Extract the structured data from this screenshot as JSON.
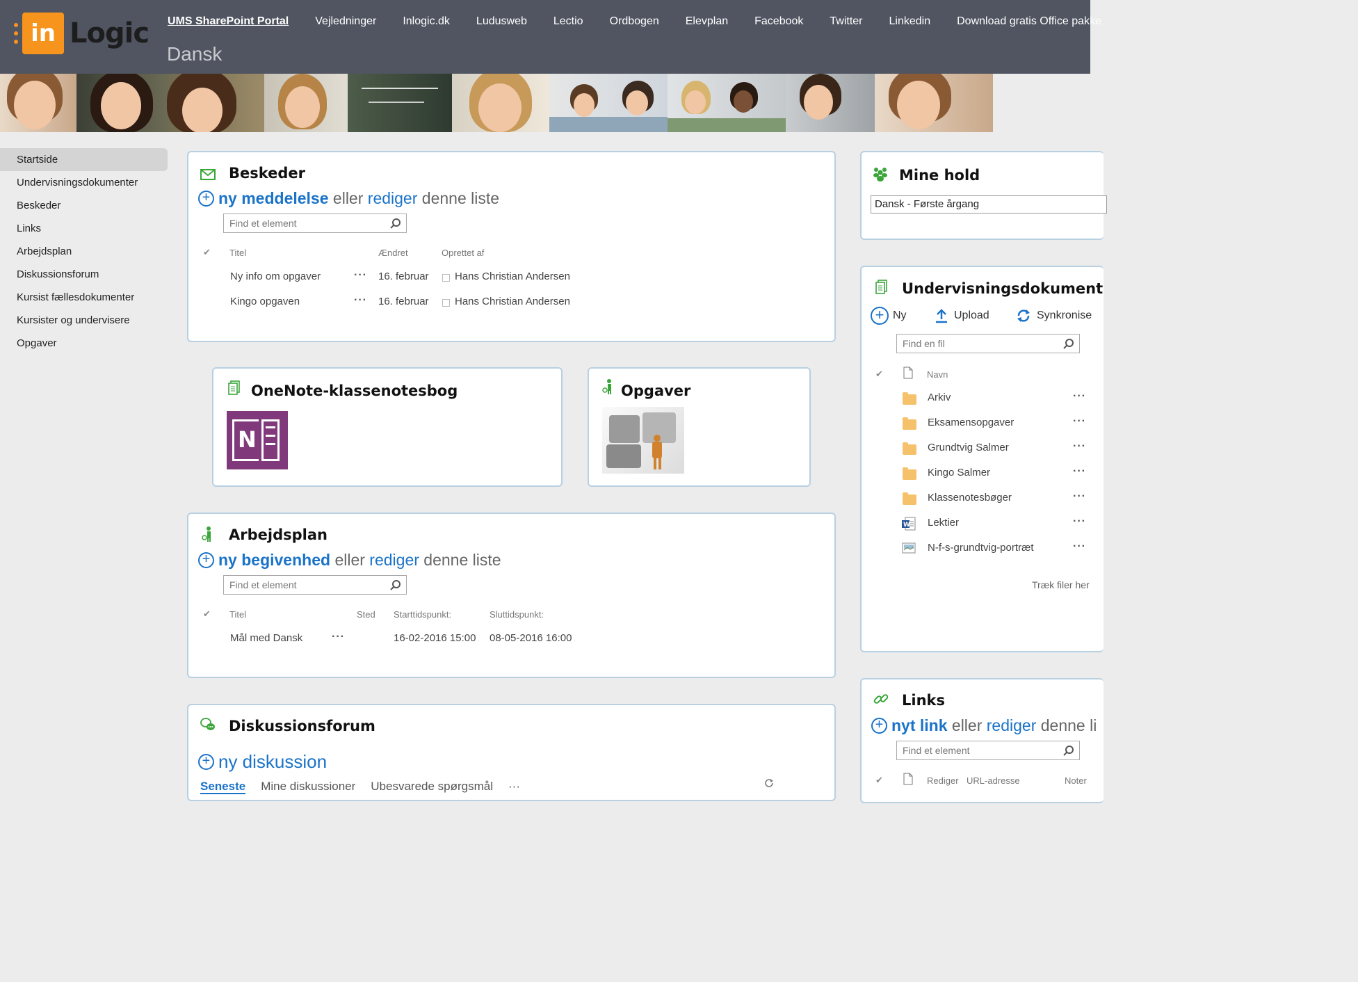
{
  "logo": {
    "badge": "in",
    "word": "Logic"
  },
  "topnav": [
    "UMS SharePoint Portal",
    "Vejledninger",
    "Inlogic.dk",
    "Ludusweb",
    "Lectio",
    "Ordbogen",
    "Elevplan",
    "Facebook",
    "Twitter",
    "Linkedin",
    "Download gratis Office pakke"
  ],
  "site_title": "Dansk",
  "leftnav": [
    "Startside",
    "Undervisningsdokumenter",
    "Beskeder",
    "Links",
    "Arbejdsplan",
    "Diskussionsforum",
    "Kursist fællesdokumenter",
    "Kursister og undervisere",
    "Opgaver"
  ],
  "beskeder": {
    "title": "Beskeder",
    "add_new": "ny meddelelse",
    "or": "eller",
    "edit": "rediger",
    "this_list": "denne liste",
    "search_placeholder": "Find et element",
    "columns": {
      "title": "Titel",
      "modified": "Ændret",
      "created_by": "Oprettet af"
    },
    "rows": [
      {
        "title": "Ny info om opgaver",
        "modified": "16. februar",
        "created_by": "Hans Christian Andersen"
      },
      {
        "title": "Kingo opgaven",
        "modified": "16. februar",
        "created_by": "Hans Christian Andersen"
      }
    ]
  },
  "onenote": {
    "title": "OneNote-klassenotesbog",
    "app_letter": "N"
  },
  "opgaver": {
    "title": "Opgaver"
  },
  "arbejdsplan": {
    "title": "Arbejdsplan",
    "add_new": "ny begivenhed",
    "or": "eller",
    "edit": "rediger",
    "this_list": "denne liste",
    "search_placeholder": "Find et element",
    "columns": {
      "title": "Titel",
      "place": "Sted",
      "start": "Starttidspunkt:",
      "end": "Sluttidspunkt:"
    },
    "rows": [
      {
        "title": "Mål med Dansk",
        "place": "",
        "start": "16-02-2016 15:00",
        "end": "08-05-2016 16:00"
      }
    ]
  },
  "diskussionsforum": {
    "title": "Diskussionsforum",
    "add_new": "ny diskussion",
    "tabs": [
      "Seneste",
      "Mine diskussioner",
      "Ubesvarede spørgsmål"
    ]
  },
  "mine_hold": {
    "title": "Mine hold",
    "selected": "Dansk - Første årgang"
  },
  "undervisningsdokumenter": {
    "title": "Undervisningsdokumenter",
    "new": "Ny",
    "upload": "Upload",
    "sync": "Synkronise",
    "search_placeholder": "Find en fil",
    "column_name": "Navn",
    "files": [
      {
        "name": "Arkiv",
        "type": "folder"
      },
      {
        "name": "Eksamensopgaver",
        "type": "folder"
      },
      {
        "name": "Grundtvig Salmer",
        "type": "folder"
      },
      {
        "name": "Kingo Salmer",
        "type": "folder"
      },
      {
        "name": "Klassenotesbøger",
        "type": "folder"
      },
      {
        "name": "Lektier",
        "type": "word"
      },
      {
        "name": "N-f-s-grundtvig-portræt",
        "type": "image"
      }
    ],
    "drop_hint": "Træk filer her"
  },
  "links": {
    "title": "Links",
    "add_new": "nyt link",
    "or": "eller",
    "edit": "rediger",
    "this_list": "denne li",
    "search_placeholder": "Find et element",
    "columns": {
      "edit": "Rediger",
      "url": "URL-adresse",
      "notes": "Noter"
    }
  },
  "colors": {
    "header": "#505561",
    "accent": "#1a73c8",
    "logo_orange": "#f7941d",
    "panel_border": "#b7d0e2",
    "onenote_purple": "#80397b"
  }
}
